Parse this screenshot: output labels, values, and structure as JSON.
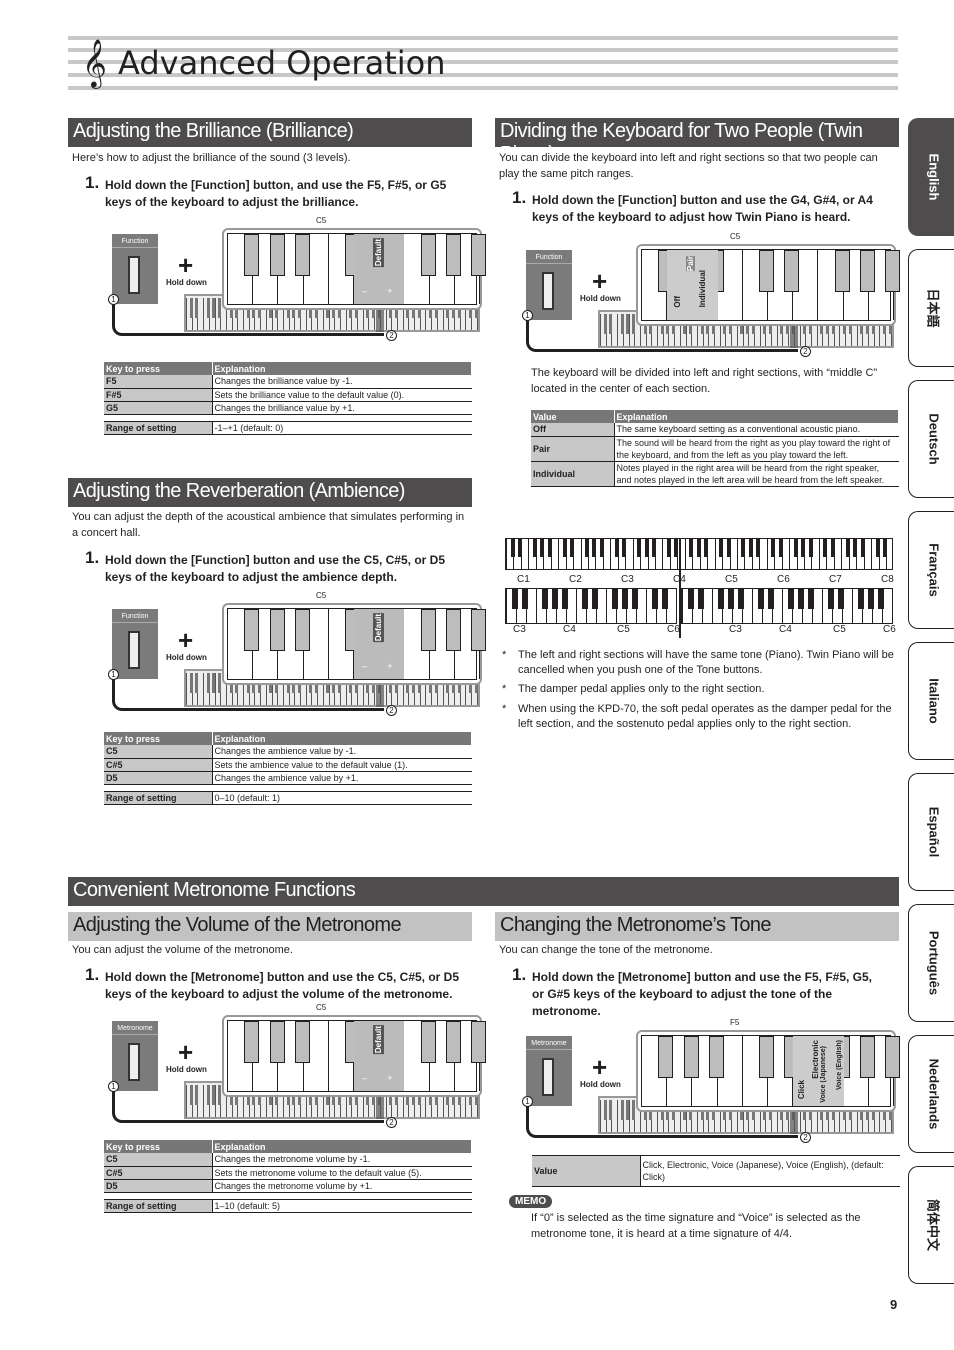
{
  "page": {
    "title": "Advanced Operation",
    "clef_icon": "treble-clef-icon",
    "page_number": "9"
  },
  "side_tabs": [
    {
      "label": "English",
      "active": true
    },
    {
      "label": "日本語",
      "active": false
    },
    {
      "label": "Deutsch",
      "active": false
    },
    {
      "label": "Français",
      "active": false
    },
    {
      "label": "Italiano",
      "active": false
    },
    {
      "label": "Español",
      "active": false
    },
    {
      "label": "Português",
      "active": false
    },
    {
      "label": "Nederlands",
      "active": false
    },
    {
      "label": "简体中文",
      "active": false
    }
  ],
  "brilliance": {
    "heading": "Adjusting the Brilliance (Brilliance)",
    "intro": "Here’s how to adjust the brilliance of the sound (3 levels).",
    "step_num": "1.",
    "step": "Hold down the [Function] button, and use the F5, F#5, or G5 keys of the keyboard to adjust the brilliance.",
    "diagram": {
      "button": "Function",
      "hold": "Hold down",
      "key_label": "C5",
      "default": "Default",
      "minus": "–",
      "plus": "+",
      "c1": "1",
      "c2": "2"
    },
    "table": {
      "headers": [
        "Key to press",
        "Explanation"
      ],
      "rows": [
        [
          "F5",
          "Changes the brilliance value by -1."
        ],
        [
          "F#5",
          "Sets the brilliance value to the default value (0)."
        ],
        [
          "G5",
          "Changes the brilliance value by +1."
        ]
      ],
      "range_label": "Range of setting",
      "range_value": "-1–+1 (default: 0)"
    }
  },
  "ambience": {
    "heading": "Adjusting the Reverberation (Ambience)",
    "intro": "You can adjust the depth of the acoustical ambience that simulates performing in a concert hall.",
    "step_num": "1.",
    "step": "Hold down the [Function] button and use the C5, C#5, or D5 keys of the keyboard to adjust the ambience depth.",
    "diagram": {
      "button": "Function",
      "hold": "Hold down",
      "key_label": "C5",
      "default": "Default",
      "minus": "–",
      "plus": "+",
      "c1": "1",
      "c2": "2"
    },
    "table": {
      "headers": [
        "Key to press",
        "Explanation"
      ],
      "rows": [
        [
          "C5",
          "Changes the ambience value by -1."
        ],
        [
          "C#5",
          "Sets the ambience value to the default value (1)."
        ],
        [
          "D5",
          "Changes the ambience value by +1."
        ]
      ],
      "range_label": "Range of setting",
      "range_value": "0–10 (default: 1)"
    }
  },
  "twin_piano": {
    "heading": "Dividing the Keyboard for Two People (Twin Piano)",
    "intro": "You can divide the keyboard into left and right sections so that two people can play the same pitch ranges.",
    "step_num": "1.",
    "step": "Hold down the [Function] button and use the G4, G#4, or A4 keys of the keyboard to adjust how Twin Piano is heard.",
    "diagram": {
      "button": "Function",
      "hold": "Hold down",
      "key_label": "C5",
      "off": "Off",
      "pair": "Pair",
      "individual": "Individual",
      "c1": "1",
      "c2": "2"
    },
    "after": "The keyboard will be divided into left and right sections, with “middle C” located in the center of each section.",
    "table": {
      "headers": [
        "Value",
        "Explanation"
      ],
      "rows": [
        [
          "Off",
          "The same keyboard setting as a conventional acoustic piano."
        ],
        [
          "Pair",
          "The sound will be heard from the right as you play toward the right of the keyboard, and from the left as you play toward the left."
        ],
        [
          "Individual",
          "Notes played in the right area will be heard from the right speaker, and notes played in the left area will be heard from the left speaker."
        ]
      ]
    },
    "range_top": [
      "C1",
      "C2",
      "C3",
      "C4",
      "C5",
      "C6",
      "C7",
      "C8"
    ],
    "range_bottom": [
      "C3",
      "C4",
      "C5",
      "C6",
      "C3",
      "C4",
      "C5",
      "C6"
    ],
    "notes": [
      "The left and right sections will have the same tone (Piano). Twin Piano will be cancelled when you push one of the Tone buttons.",
      "The damper pedal applies only to the right section.",
      "When using the KPD-70, the soft pedal operates as the damper pedal for the left section, and the sostenuto pedal applies only to the right section."
    ]
  },
  "metronome": {
    "heading": "Convenient Metronome Functions",
    "volume": {
      "heading": "Adjusting the Volume of the Metronome",
      "intro": "You can adjust the volume of the metronome.",
      "step_num": "1.",
      "step": "Hold down the [Metronome] button and use the C5, C#5, or D5 keys of the keyboard to adjust the volume of the metronome.",
      "diagram": {
        "button": "Metronome",
        "hold": "Hold down",
        "key_label": "C5",
        "default": "Default",
        "minus": "–",
        "plus": "+",
        "c1": "1",
        "c2": "2"
      },
      "table": {
        "headers": [
          "Key to press",
          "Explanation"
        ],
        "rows": [
          [
            "C5",
            "Changes the metronome volume by -1."
          ],
          [
            "C#5",
            "Sets the metronome volume to the default value (5)."
          ],
          [
            "D5",
            "Changes the metronome volume by +1."
          ]
        ],
        "range_label": "Range of setting",
        "range_value": "1–10 (default: 5)"
      }
    },
    "tone": {
      "heading": "Changing the Metronome’s Tone",
      "intro": "You can change the tone of the metronome.",
      "step_num": "1.",
      "step": "Hold down the [Metronome] button and use the F5, F#5, G5, or G#5 keys of the keyboard to adjust the tone of the metronome.",
      "diagram": {
        "button": "Metronome",
        "hold": "Hold down",
        "key_label": "F5",
        "click": "Click",
        "electronic": "Electronic",
        "voice_jp": "Voice (Japanese)",
        "voice_en": "Voice (English)",
        "c1": "1",
        "c2": "2"
      },
      "table": {
        "value_label": "Value",
        "value_text": "Click, Electronic, Voice (Japanese), Voice (English), (default: Click)"
      },
      "memo_label": "MEMO",
      "memo_text": "If “0” is selected as the time signature and “Voice” is selected as the metronome tone, it is heard at a time signature of 4/4."
    }
  }
}
